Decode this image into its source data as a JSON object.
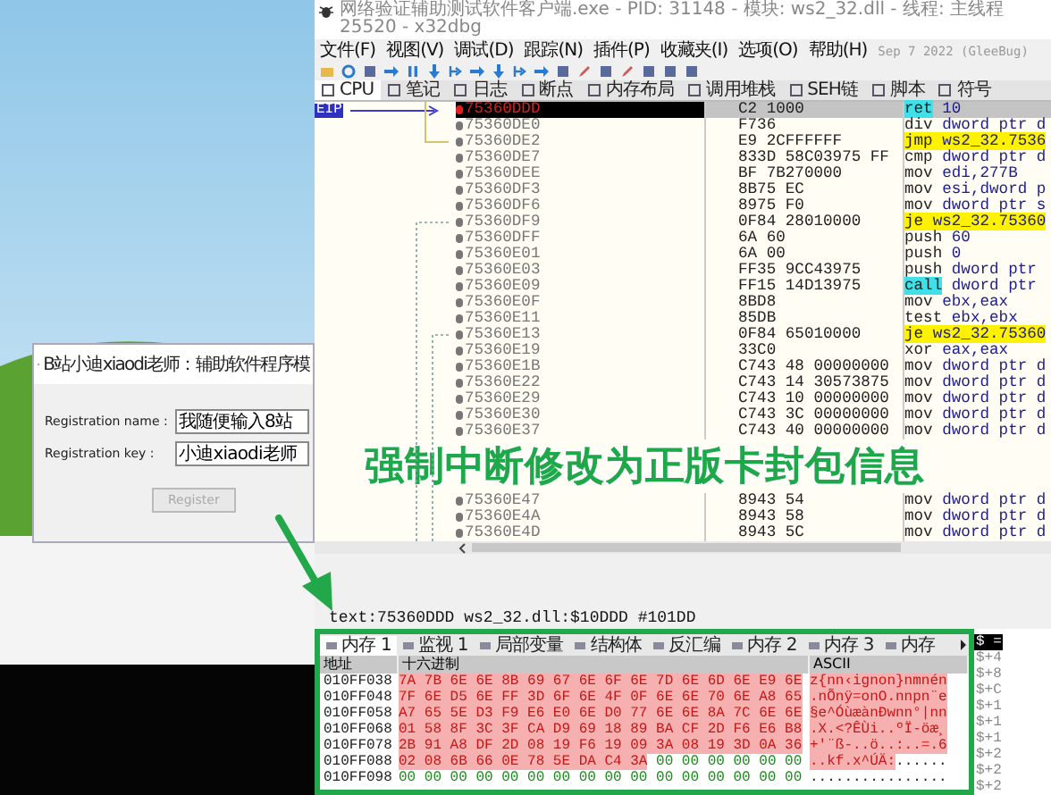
{
  "dialog": {
    "title": "B站小迪xiaodi老师：辅助软件程序模",
    "fields": [
      {
        "label": "Registration name :",
        "value": "我随便输入8站"
      },
      {
        "label": "Registration key :",
        "value": "小迪xiaodi老师"
      }
    ],
    "button": {
      "label": "Register",
      "disabled": true
    }
  },
  "debugger": {
    "title": "网络验证辅助测试软件客户端.exe - PID: 31148 - 模块: ws2_32.dll - 线程: 主线程 25520 - x32dbg",
    "menu": [
      "文件(F)",
      "视图(V)",
      "调试(D)",
      "跟踪(N)",
      "插件(P)",
      "收藏夹(I)",
      "选项(O)",
      "帮助(H)"
    ],
    "build_date": "Sep 7 2022 (GleeBug)",
    "tabs": [
      {
        "label": "CPU",
        "selected": true
      },
      {
        "label": "笔记",
        "selected": false
      },
      {
        "label": "日志",
        "selected": false
      },
      {
        "label": "断点",
        "selected": false
      },
      {
        "label": "内存布局",
        "selected": false
      },
      {
        "label": "调用堆栈",
        "selected": false
      },
      {
        "label": "SEH链",
        "selected": false
      },
      {
        "label": "脚本",
        "selected": false
      },
      {
        "label": "符号",
        "selected": false
      }
    ],
    "eip_label": "EIP",
    "rows_before": [
      {
        "address": "75360DDD",
        "bytes": "C2 1000",
        "mnemonic": "ret",
        "operands": "10",
        "kind": "return",
        "selected": true
      },
      {
        "address": "75360DE0",
        "bytes": "F736",
        "mnemonic": "div",
        "operands": "dword ptr d",
        "kind": "plain",
        "selected": false
      },
      {
        "address": "75360DE2",
        "bytes": "E9 2CFFFFFF",
        "mnemonic": "jmp",
        "operands": "ws2_32.7536",
        "kind": "jump",
        "selected": false
      },
      {
        "address": "75360DE7",
        "bytes": "833D 58C03975 FF",
        "mnemonic": "cmp",
        "operands": "dword ptr d",
        "kind": "plain",
        "selected": false
      },
      {
        "address": "75360DEE",
        "bytes": "BF 7B270000",
        "mnemonic": "mov",
        "operands": "edi,277B",
        "kind": "plain",
        "selected": false
      },
      {
        "address": "75360DF3",
        "bytes": "8B75 EC",
        "mnemonic": "mov",
        "operands": "esi,dword p",
        "kind": "plain",
        "selected": false
      },
      {
        "address": "75360DF6",
        "bytes": "8975 F0",
        "mnemonic": "mov",
        "operands": "dword ptr s",
        "kind": "plain",
        "selected": false
      },
      {
        "address": "75360DF9",
        "bytes": "0F84 28010000",
        "mnemonic": "je",
        "operands": "ws2_32.75360",
        "kind": "jump",
        "selected": false
      },
      {
        "address": "75360DFF",
        "bytes": "6A 60",
        "mnemonic": "push",
        "operands": "60",
        "kind": "plain",
        "selected": false
      },
      {
        "address": "75360E01",
        "bytes": "6A 00",
        "mnemonic": "push",
        "operands": "0",
        "kind": "plain",
        "selected": false
      },
      {
        "address": "75360E03",
        "bytes": "FF35 9CC43975",
        "mnemonic": "push",
        "operands": "dword ptr",
        "kind": "plain",
        "selected": false
      },
      {
        "address": "75360E09",
        "bytes": "FF15 14D13975",
        "mnemonic": "call",
        "operands": "dword ptr",
        "kind": "call",
        "selected": false
      },
      {
        "address": "75360E0F",
        "bytes": "8BD8",
        "mnemonic": "mov",
        "operands": "ebx,eax",
        "kind": "plain",
        "selected": false
      },
      {
        "address": "75360E11",
        "bytes": "85DB",
        "mnemonic": "test",
        "operands": "ebx,ebx",
        "kind": "plain",
        "selected": false
      },
      {
        "address": "75360E13",
        "bytes": "0F84 65010000",
        "mnemonic": "je",
        "operands": "ws2_32.75360",
        "kind": "jump",
        "selected": false
      },
      {
        "address": "75360E19",
        "bytes": "33C0",
        "mnemonic": "xor",
        "operands": "eax,eax",
        "kind": "plain",
        "selected": false
      },
      {
        "address": "75360E1B",
        "bytes": "C743 48 00000000",
        "mnemonic": "mov",
        "operands": "dword ptr d",
        "kind": "plain",
        "selected": false
      },
      {
        "address": "75360E22",
        "bytes": "C743 14 30573875",
        "mnemonic": "mov",
        "operands": "dword ptr d",
        "kind": "plain",
        "selected": false
      },
      {
        "address": "75360E29",
        "bytes": "C743 10 00000000",
        "mnemonic": "mov",
        "operands": "dword ptr d",
        "kind": "plain",
        "selected": false
      },
      {
        "address": "75360E30",
        "bytes": "C743 3C 00000000",
        "mnemonic": "mov",
        "operands": "dword ptr d",
        "kind": "plain",
        "selected": false
      },
      {
        "address": "75360E37",
        "bytes": "C743 40 00000000",
        "mnemonic": "mov",
        "operands": "dword ptr d",
        "kind": "plain",
        "selected": false
      }
    ],
    "caption": "强制中断修改为正版卡封包信息",
    "rows_after": [
      {
        "address": "75360E47",
        "bytes": "8943 54",
        "mnemonic": "mov",
        "operands": "dword ptr d",
        "kind": "plain",
        "selected": false
      },
      {
        "address": "75360E4A",
        "bytes": "8943 58",
        "mnemonic": "mov",
        "operands": "dword ptr d",
        "kind": "plain",
        "selected": false
      },
      {
        "address": "75360E4D",
        "bytes": "8943 5C",
        "mnemonic": "mov",
        "operands": "dword ptr d",
        "kind": "plain",
        "selected": false
      }
    ],
    "info_line": "text:75360DDD ws2_32.dll:$10DDD #101DD",
    "memory_tabs": [
      {
        "label": "内存 1",
        "selected": true
      },
      {
        "label": "监视 1",
        "selected": false
      },
      {
        "label": "局部变量",
        "selected": false
      },
      {
        "label": "结构体",
        "selected": false
      },
      {
        "label": "反汇编",
        "selected": false
      },
      {
        "label": "内存 2",
        "selected": false
      },
      {
        "label": "内存 3",
        "selected": false
      },
      {
        "label": "内存",
        "selected": false
      }
    ],
    "memory_columns": [
      "地址",
      "十六进制",
      "ASCII"
    ],
    "memory_rows": [
      {
        "address": "010FF038",
        "hex_changed": "7A 7B 6E 6E 8B 69 67 6E 6F 6E 7D 6E 6D 6E E9 6E",
        "ascii_changed": "z{nn‹ignon}nmnén"
      },
      {
        "address": "010FF048",
        "hex_changed": "7F 6E D5 6E FF 3D 6F 6E 4F 0F 6E 6E 70 6E A8 65",
        "ascii_changed": ".nÕnÿ=onO.nnpn¨e"
      },
      {
        "address": "010FF058",
        "hex_changed": "A7 65 5E D3 F9 E6 E0 6E D0 77 6E 6E 8A 7C 6E 6E",
        "ascii_changed": "§e^ÓùæànÐwnn°|nn"
      },
      {
        "address": "010FF068",
        "hex_changed": "01 58 8F 3C 3F CA D9 69 18 89 BA CF 2D F6 E6 B8",
        "ascii_changed": ".X.<?ÊÙi..ºÏ-öæ¸"
      },
      {
        "address": "010FF078",
        "hex_changed": "2B 91 A8 DF 2D 08 19 F6 19 09 3A 08 19 3D 0A 36",
        "ascii_changed": "+'¨ß-..ö..:..=.6"
      },
      {
        "address": "010FF088",
        "hex_changed": "02 08 6B 66 0E 78 5E DA C4 3A",
        "hex_plain": "00 00 00 00 00 00",
        "ascii_changed": "..kf.x^ÚÄ:",
        "ascii_plain": "......"
      },
      {
        "address": "010FF098",
        "hex_plain": "00 00 00 00 00 00 00 00 00 00 00 00 00 00 00 00",
        "ascii_plain": "................"
      }
    ],
    "stack_header": "$ =",
    "stack_rows": [
      "$+4",
      "$+8",
      "$+C",
      "$+1",
      "$+1",
      "$+1",
      "$+2",
      "$+2",
      "$+2"
    ]
  }
}
